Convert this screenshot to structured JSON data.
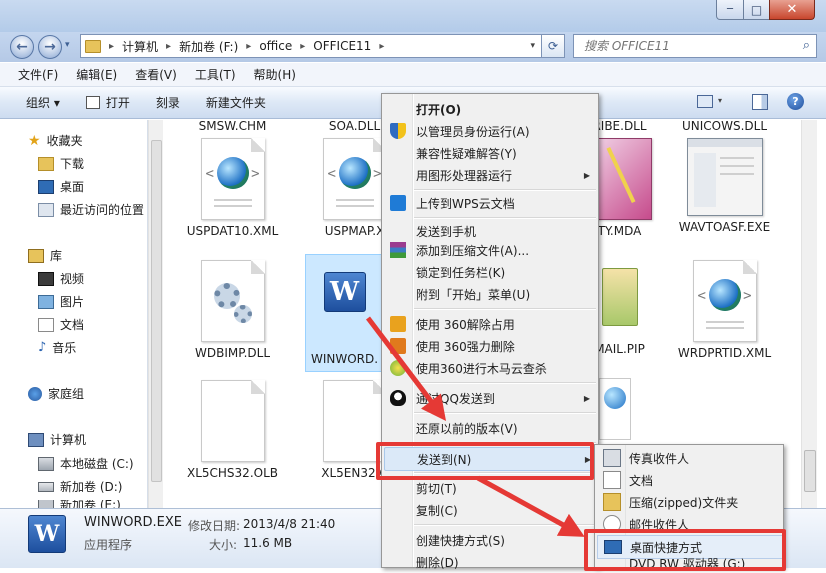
{
  "window": {
    "min_glyph": "─",
    "max_glyph": "□",
    "close_glyph": "✕"
  },
  "address": {
    "crumbs": [
      "计算机",
      "新加卷 (F:)",
      "office",
      "OFFICE11"
    ]
  },
  "search": {
    "placeholder": "搜索 OFFICE11"
  },
  "menubar": [
    "文件(F)",
    "编辑(E)",
    "查看(V)",
    "工具(T)",
    "帮助(H)"
  ],
  "toolbar": {
    "organize": "组织 ▾",
    "open": "打开",
    "burn": "刻录",
    "new_folder": "新建文件夹"
  },
  "sidebar": {
    "favorites": "收藏夹",
    "downloads": "下载",
    "desktop": "桌面",
    "recent": "最近访问的位置",
    "libraries": "库",
    "videos": "视频",
    "pictures": "图片",
    "documents": "文档",
    "music": "音乐",
    "homegroup": "家庭组",
    "computer": "计算机",
    "local_c": "本地磁盘 (C:)",
    "vol_d": "新加卷 (D:)",
    "vol_e": "新加卷 (E:)"
  },
  "files": {
    "top_row": [
      "SMSW.CHM",
      "SOA.DLL",
      "RIBE.DLL",
      "UNICOWS.DLL"
    ],
    "row1": [
      "USPDAT10.XML",
      "USPMAP.X",
      "TY.MDA",
      "WAVTOASF.EXE"
    ],
    "row2": [
      "WDBIMP.DLL",
      "WINWORD.",
      "MAIL.PIP",
      "WRDPRTID.XML"
    ],
    "row3": [
      "XL5CHS32.OLB",
      "XL5EN32.C"
    ]
  },
  "details": {
    "name": "WINWORD.EXE",
    "modified_label": "修改日期:",
    "modified_value": "2013/4/8 21:40",
    "type": "应用程序",
    "size_label": "大小:",
    "size_value": "11.6 MB"
  },
  "context_menu": [
    "打开(O)",
    "以管理员身份运行(A)",
    "兼容性疑难解答(Y)",
    "用图形处理器运行",
    "上传到WPS云文档",
    "发送到手机",
    "添加到压缩文件(A)...",
    "锁定到任务栏(K)",
    "附到「开始」菜单(U)",
    "使用 360解除占用",
    "使用 360强力删除",
    "使用360进行木马云查杀",
    "通过QQ发送到",
    "还原以前的版本(V)",
    "发送到(N)",
    "剪切(T)",
    "复制(C)",
    "创建快捷方式(S)",
    "删除(D)"
  ],
  "send_to_menu": [
    "传真收件人",
    "文档",
    "压缩(zipped)文件夹",
    "邮件收件人",
    "桌面快捷方式",
    "DVD RW 驱动器 (G:)"
  ],
  "colors": {
    "highlight": "#e53935",
    "accent": "#3a6fb5",
    "selected_bg": "#cce8ff"
  }
}
